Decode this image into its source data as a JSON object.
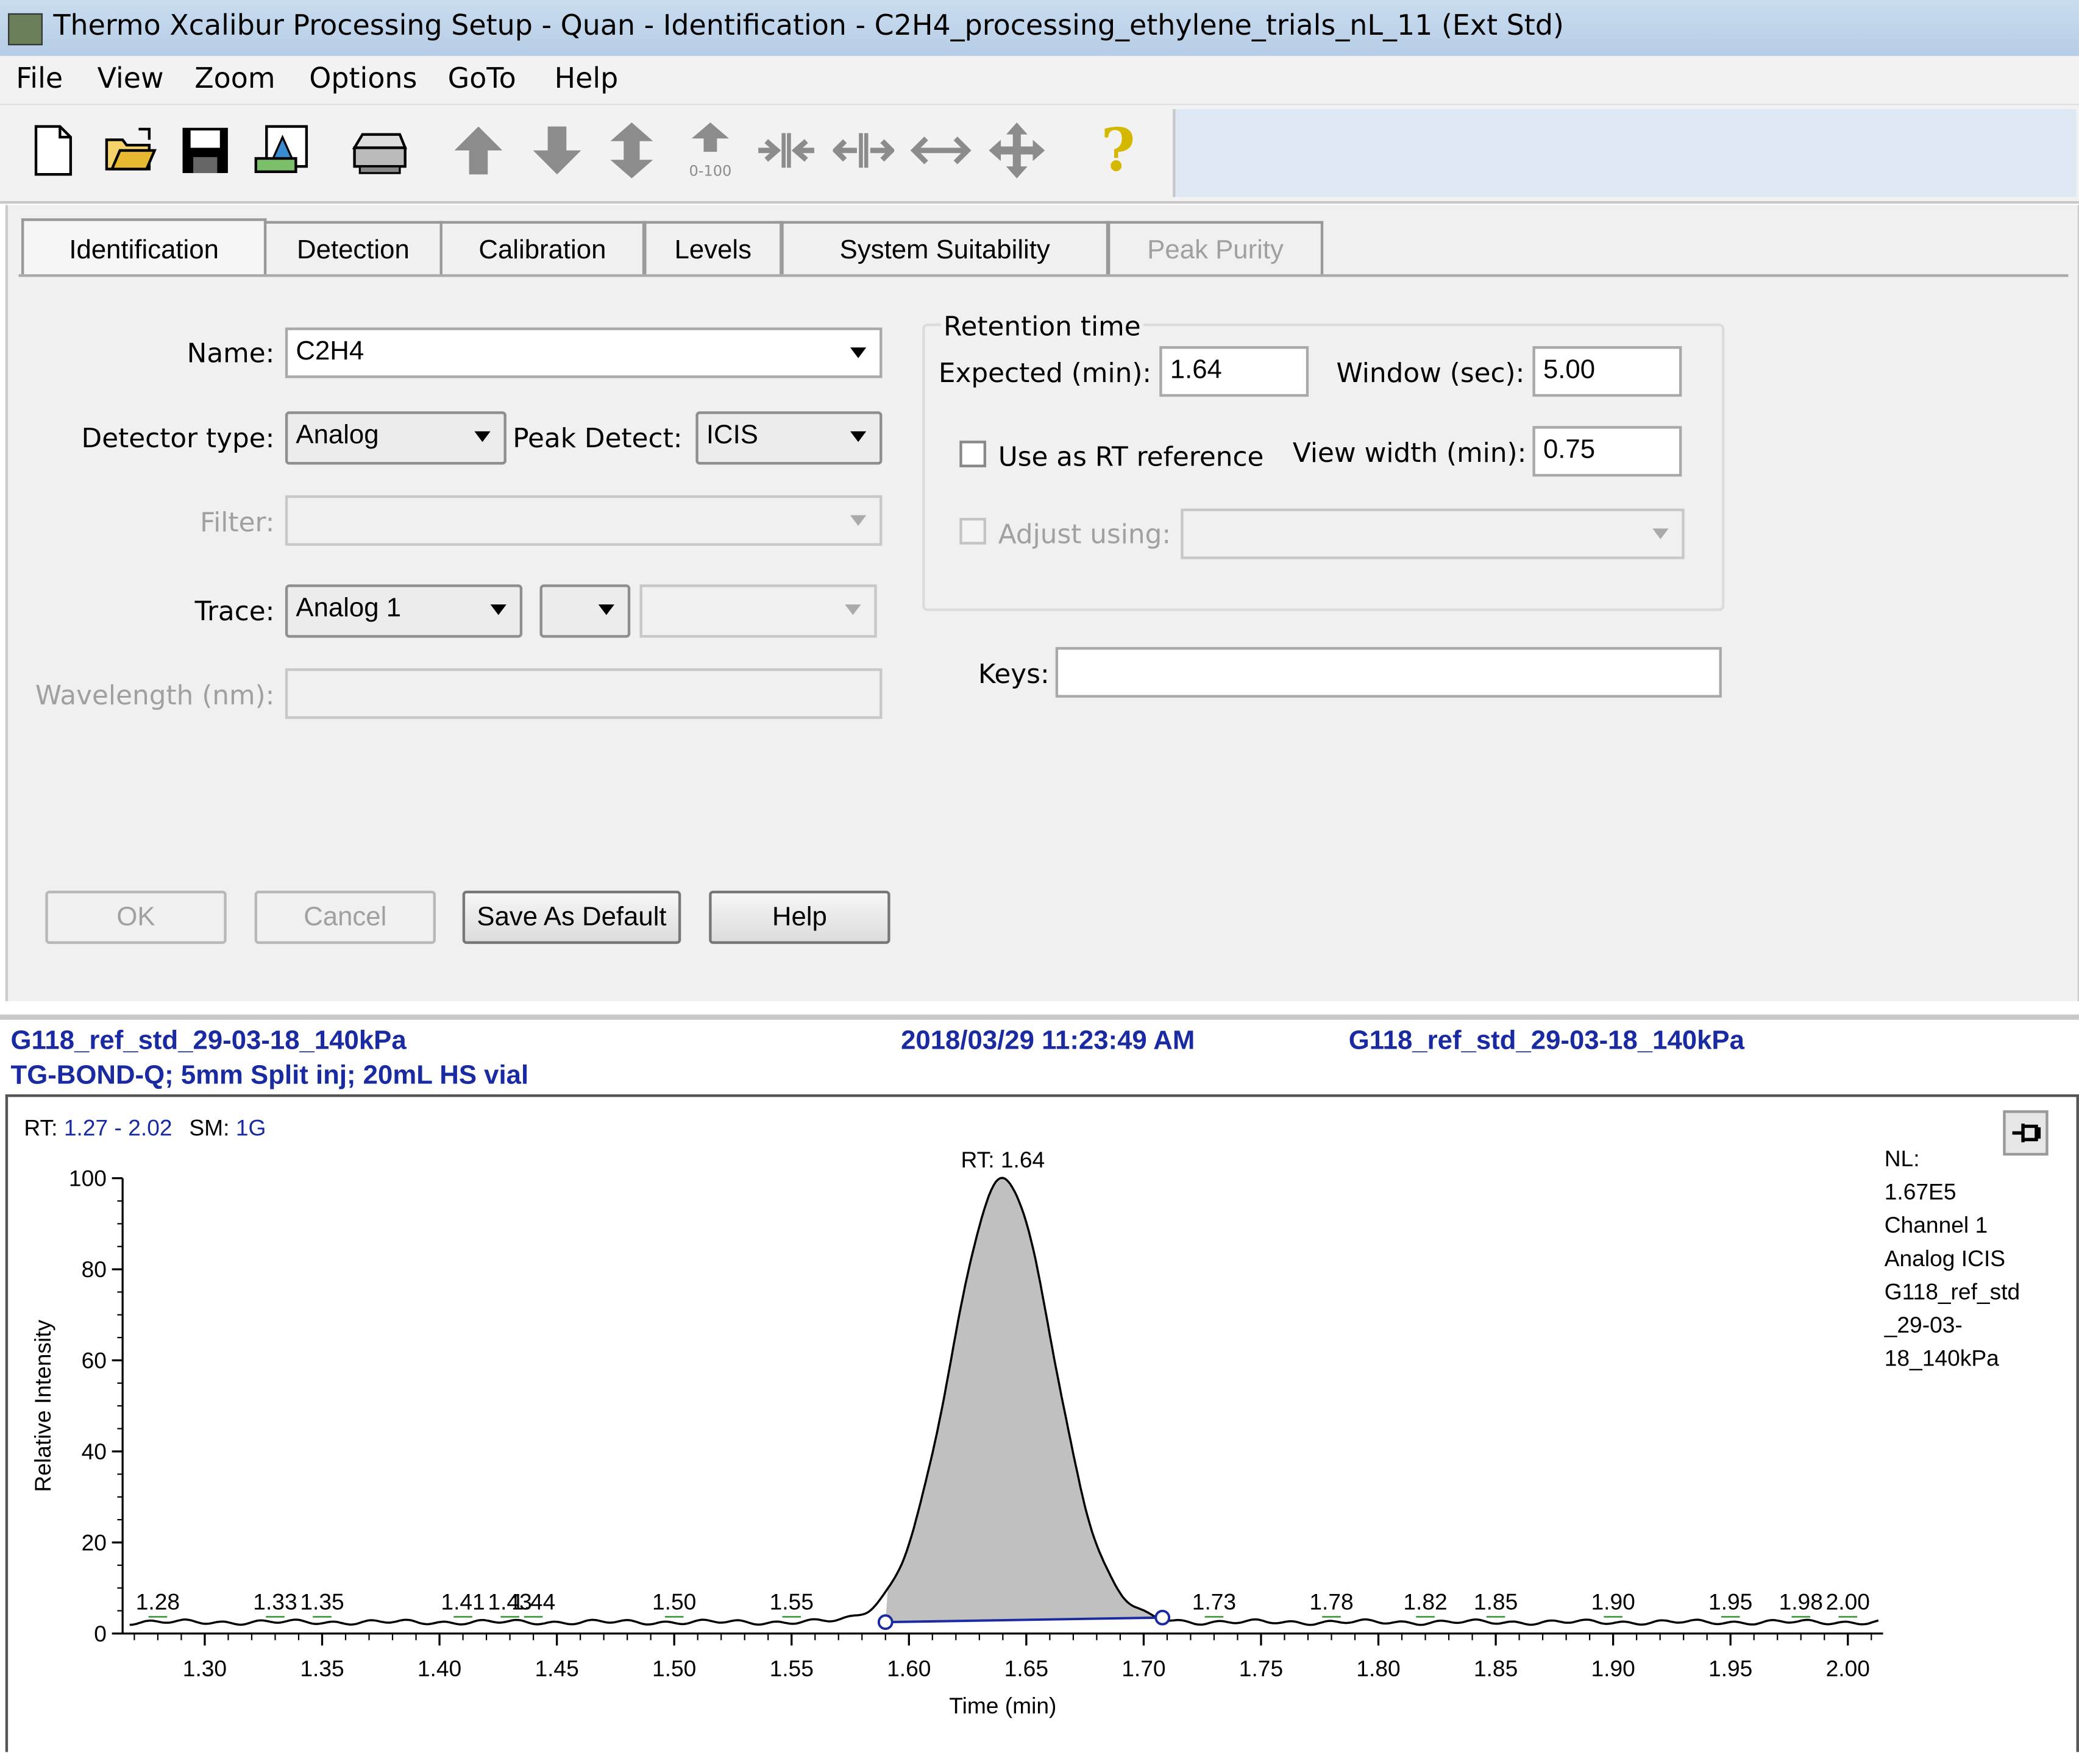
{
  "window": {
    "title": "Thermo Xcalibur Processing Setup  - Quan - Identification - C2H4_processing_ethylene_trials_nL_11 (Ext Std)"
  },
  "menu": [
    "File",
    "View",
    "Zoom",
    "Options",
    "GoTo",
    "Help"
  ],
  "toolbar": {
    "icons": [
      "new-file-icon",
      "open-folder-icon",
      "save-icon",
      "import-chromatogram-icon",
      "print-icon",
      "arrow-up-icon",
      "arrow-down-icon",
      "arrow-up-down-icon",
      "normalize-0-100-icon",
      "zoom-in-x-icon",
      "zoom-out-x-icon",
      "autoscale-x-icon",
      "pan-icon",
      "help-icon"
    ],
    "normalize_label": "0-100"
  },
  "tabs": [
    {
      "label": "Identification",
      "active": true
    },
    {
      "label": "Detection"
    },
    {
      "label": "Calibration"
    },
    {
      "label": "Levels"
    },
    {
      "label": "System Suitability"
    },
    {
      "label": "Peak Purity",
      "disabled": true
    }
  ],
  "form": {
    "name_label": "Name:",
    "name_value": "C2H4",
    "detector_type_label": "Detector type:",
    "detector_type_value": "Analog",
    "peak_detect_label": "Peak Detect:",
    "peak_detect_value": "ICIS",
    "filter_label": "Filter:",
    "trace_label": "Trace:",
    "trace_value": "Analog 1",
    "wavelength_label": "Wavelength (nm):",
    "keys_label": "Keys:"
  },
  "retention_time": {
    "group_label": "Retention time",
    "expected_label": "Expected (min):",
    "expected_value": "1.64",
    "window_label": "Window (sec):",
    "window_value": "5.00",
    "use_as_rt_reference_label": "Use as RT reference",
    "view_width_label": "View width (min):",
    "view_width_value": "0.75",
    "adjust_using_label": "Adjust using:"
  },
  "buttons": {
    "ok": "OK",
    "cancel": "Cancel",
    "save_as_default": "Save As Default",
    "help": "Help"
  },
  "chart_header": {
    "file_name": "G118_ref_std_29-03-18_140kPa",
    "method": "TG-BOND-Q; 5mm Split inj; 20mL HS vial",
    "timestamp": "2018/03/29 11:23:49 AM",
    "sample_name": "G118_ref_std_29-03-18_140kPa"
  },
  "chart_info": {
    "rt_label": "RT:",
    "rt_range": "1.27 - 2.02",
    "sm_label": "SM:",
    "sm_value": "1G",
    "nl_lines": [
      "NL:",
      "1.67E5",
      "Channel 1",
      "Analog  ICIS",
      "G118_ref_std",
      "_29-03-",
      "18_140kPa"
    ]
  },
  "chart_data": {
    "type": "line",
    "xlabel": "Time (min)",
    "ylabel": "Relative Intensity",
    "xlim": [
      1.265,
      2.015
    ],
    "ylim": [
      0,
      100
    ],
    "x_ticks": [
      "1.30",
      "1.35",
      "1.40",
      "1.45",
      "1.50",
      "1.55",
      "1.60",
      "1.65",
      "1.70",
      "1.75",
      "1.80",
      "1.85",
      "1.90",
      "1.95",
      "2.00"
    ],
    "y_ticks": [
      0,
      20,
      40,
      60,
      80,
      100
    ],
    "peak_label": "RT: 1.64",
    "peak": {
      "apex_rt": 1.64,
      "apex_intensity": 100,
      "start_rt": 1.59,
      "end_rt": 1.708,
      "start_intensity": 2.5,
      "end_intensity": 3.5
    },
    "baseline_intensity": 2.5,
    "minor_peak_labels": [
      "1.28",
      "1.33",
      "1.35",
      "1.41",
      "1.43",
      "1.44",
      "1.50",
      "1.55",
      "1.73",
      "1.78",
      "1.82",
      "1.85",
      "1.90",
      "1.95",
      "1.98",
      "2.00"
    ],
    "minor_peak_rts": [
      1.28,
      1.33,
      1.35,
      1.41,
      1.43,
      1.44,
      1.5,
      1.55,
      1.73,
      1.78,
      1.82,
      1.85,
      1.9,
      1.95,
      1.98,
      2.0
    ],
    "colors": {
      "trace": "#000000",
      "peak_fill": "#c0c0c0",
      "baseline_fit": "#1a2aa0",
      "header_text": "#1a2aa0"
    }
  }
}
